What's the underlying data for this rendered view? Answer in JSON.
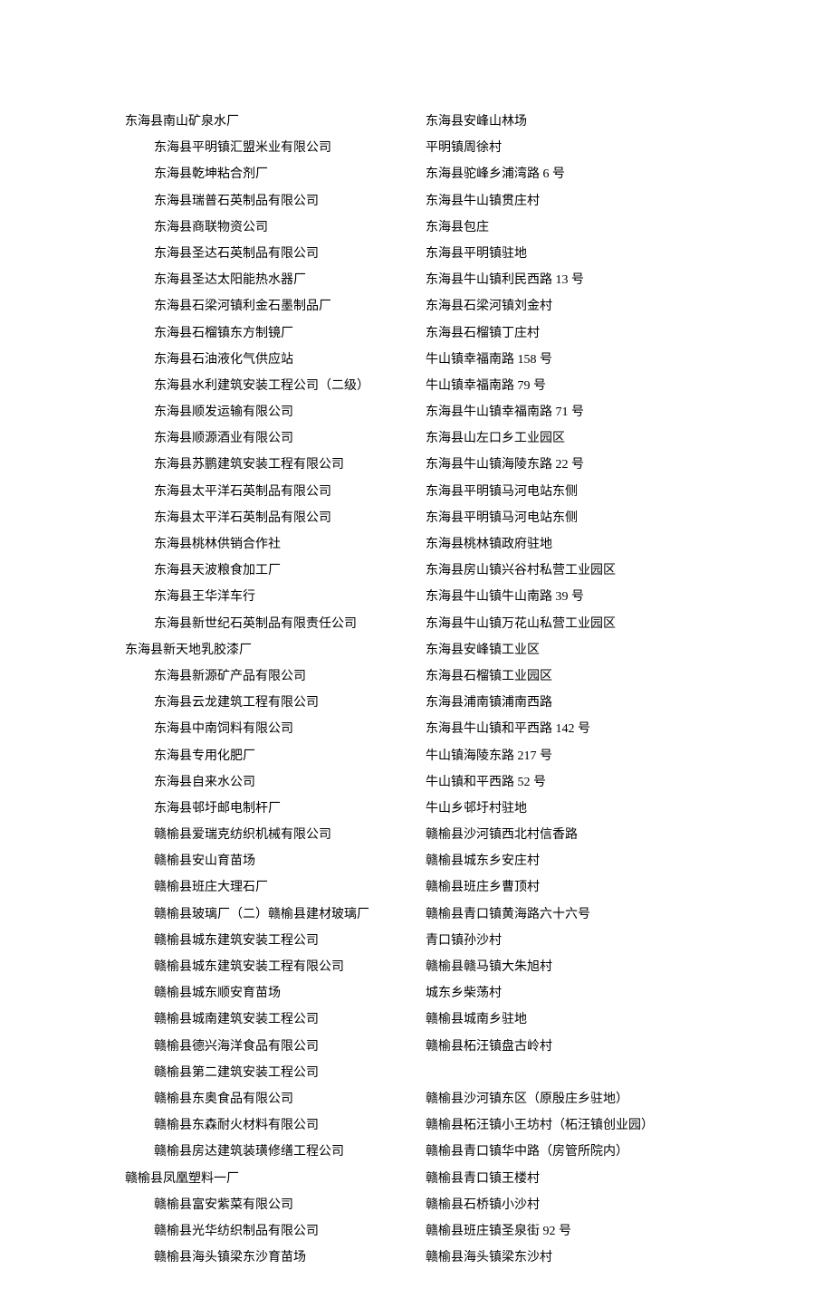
{
  "rows": [
    {
      "company": "东海县南山矿泉水厂",
      "address": "东海县安峰山林场",
      "outdent": true
    },
    {
      "company": "东海县平明镇汇盟米业有限公司",
      "address": "平明镇周徐村"
    },
    {
      "company": "东海县乾坤粘合剂厂",
      "address": "东海县驼峰乡浦湾路 6 号"
    },
    {
      "company": "东海县瑞普石英制品有限公司",
      "address": "东海县牛山镇贯庄村"
    },
    {
      "company": "东海县商联物资公司",
      "address": "东海县包庄"
    },
    {
      "company": "东海县圣达石英制品有限公司",
      "address": "东海县平明镇驻地"
    },
    {
      "company": "东海县圣达太阳能热水器厂",
      "address": "东海县牛山镇利民西路 13 号"
    },
    {
      "company": "东海县石梁河镇利金石墨制品厂",
      "address": "东海县石梁河镇刘金村"
    },
    {
      "company": "东海县石榴镇东方制镜厂",
      "address": "东海县石榴镇丁庄村"
    },
    {
      "company": "东海县石油液化气供应站",
      "address": "牛山镇幸福南路 158 号"
    },
    {
      "company": "东海县水利建筑安装工程公司（二级）",
      "address": "牛山镇幸福南路 79 号"
    },
    {
      "company": "东海县顺发运输有限公司",
      "address": "东海县牛山镇幸福南路 71 号"
    },
    {
      "company": "东海县顺源酒业有限公司",
      "address": "东海县山左口乡工业园区"
    },
    {
      "company": "东海县苏鹏建筑安装工程有限公司",
      "address": "东海县牛山镇海陵东路 22 号"
    },
    {
      "company": "东海县太平洋石英制品有限公司",
      "address": "东海县平明镇马河电站东侧"
    },
    {
      "company": "东海县太平洋石英制品有限公司",
      "address": "东海县平明镇马河电站东侧"
    },
    {
      "company": "东海县桃林供销合作社",
      "address": "东海县桃林镇政府驻地"
    },
    {
      "company": "东海县天波粮食加工厂",
      "address": "东海县房山镇兴谷村私营工业园区"
    },
    {
      "company": "东海县王华洋车行",
      "address": "东海县牛山镇牛山南路 39 号"
    },
    {
      "company": "东海县新世纪石英制品有限责任公司",
      "address": "东海县牛山镇万花山私营工业园区"
    },
    {
      "company": "东海县新天地乳胶漆厂",
      "address": "东海县安峰镇工业区",
      "outdent": true
    },
    {
      "company": "东海县新源矿产品有限公司",
      "address": "东海县石榴镇工业园区"
    },
    {
      "company": "东海县云龙建筑工程有限公司",
      "address": "东海县浦南镇浦南西路"
    },
    {
      "company": "东海县中南饲料有限公司",
      "address": "东海县牛山镇和平西路 142 号"
    },
    {
      "company": "东海县专用化肥厂",
      "address": "牛山镇海陵东路 217 号"
    },
    {
      "company": "东海县自来水公司",
      "address": "牛山镇和平西路 52 号"
    },
    {
      "company": "东海县邨圩邮电制杆厂",
      "address": "牛山乡邨圩村驻地"
    },
    {
      "company": "赣榆县爱瑞克纺织机械有限公司",
      "address": "赣榆县沙河镇西北村信香路"
    },
    {
      "company": "赣榆县安山育苗场",
      "address": "赣榆县城东乡安庄村"
    },
    {
      "company": "赣榆县班庄大理石厂",
      "address": "赣榆县班庄乡曹顶村"
    },
    {
      "company": "赣榆县玻璃厂（二）赣榆县建材玻璃厂",
      "address": "赣榆县青口镇黄海路六十六号"
    },
    {
      "company": "赣榆县城东建筑安装工程公司",
      "address": "青口镇孙沙村"
    },
    {
      "company": "赣榆县城东建筑安装工程有限公司",
      "address": "赣榆县赣马镇大朱旭村"
    },
    {
      "company": "赣榆县城东顺安育苗场",
      "address": "城东乡柴荡村"
    },
    {
      "company": "赣榆县城南建筑安装工程公司",
      "address": "赣榆县城南乡驻地"
    },
    {
      "company": "赣榆县德兴海洋食品有限公司",
      "address": "赣榆县柘汪镇盘古岭村"
    },
    {
      "company": "赣榆县第二建筑安装工程公司",
      "address": ""
    },
    {
      "company": "赣榆县东奥食品有限公司",
      "address": "赣榆县沙河镇东区（原殷庄乡驻地）"
    },
    {
      "company": "赣榆县东森耐火材料有限公司",
      "address": "赣榆县柘汪镇小王坊村（柘汪镇创业园）"
    },
    {
      "company": "赣榆县房达建筑装璜修缮工程公司",
      "address": "赣榆县青口镇华中路（房管所院内）"
    },
    {
      "company": "赣榆县凤凰塑料一厂",
      "address": "赣榆县青口镇王楼村",
      "outdent": true
    },
    {
      "company": "赣榆县富安紫菜有限公司",
      "address": "赣榆县石桥镇小沙村"
    },
    {
      "company": "赣榆县光华纺织制品有限公司",
      "address": "赣榆县班庄镇圣泉街 92 号"
    },
    {
      "company": "赣榆县海头镇梁东沙育苗场",
      "address": "赣榆县海头镇梁东沙村"
    }
  ]
}
